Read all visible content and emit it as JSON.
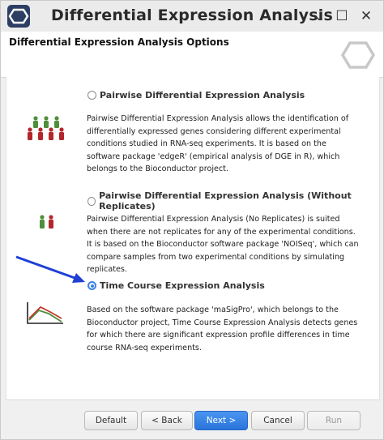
{
  "window": {
    "title": "Differential Expression Analysis",
    "minimize_symbol": "⌄",
    "maximize_symbol": "☐",
    "close_symbol": "✕"
  },
  "header": {
    "title": "Differential Expression Analysis Options"
  },
  "options": [
    {
      "title": "Pairwise Differential Expression Analysis",
      "selected": false,
      "icon": "people-group-icon",
      "description": "Pairwise Differential Expression Analysis allows the identification of differentially expressed genes considering different experimental conditions studied in RNA-seq experiments. It is based on the software package 'edgeR' (empirical analysis of DGE in R), which belongs to the Bioconductor project."
    },
    {
      "title": "Pairwise Differential Expression Analysis (Without Replicates)",
      "selected": false,
      "icon": "people-pair-icon",
      "description": "Pairwise Differential Expression Analysis (No Replicates) is suited when there are not replicates for any of the experimental conditions. It is based on the Bioconductor software package 'NOISeq', which can compare samples from two experimental conditions by simulating replicates."
    },
    {
      "title": "Time Course Expression Analysis",
      "selected": true,
      "icon": "line-chart-icon",
      "description": "Based on the software package 'maSigPro', which belongs to the Bioconductor project, Time Course Expression Analysis detects genes for which there are significant expression profile differences in time course RNA-seq experiments."
    }
  ],
  "buttons": {
    "default": "Default",
    "back": "< Back",
    "next": "Next >",
    "cancel": "Cancel",
    "run": "Run"
  },
  "colors": {
    "accent": "#2a74dc",
    "arrow": "#1f3fd6",
    "person_green": "#4f8f3a",
    "person_red": "#b3262b"
  }
}
